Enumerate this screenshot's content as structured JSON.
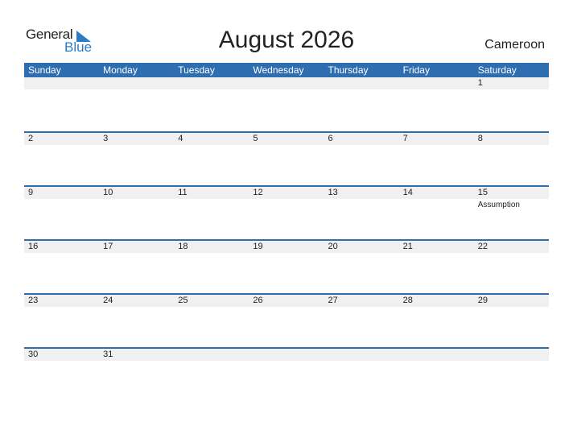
{
  "logo": {
    "text1": "General",
    "text2": "Blue"
  },
  "title": "August 2026",
  "country": "Cameroon",
  "colors": {
    "header": "#2e6eb0",
    "daybar": "#f0f0f0",
    "brand": "#2a7bc8"
  },
  "days": [
    "Sunday",
    "Monday",
    "Tuesday",
    "Wednesday",
    "Thursday",
    "Friday",
    "Saturday"
  ],
  "weeks": [
    [
      {
        "d": ""
      },
      {
        "d": ""
      },
      {
        "d": ""
      },
      {
        "d": ""
      },
      {
        "d": ""
      },
      {
        "d": ""
      },
      {
        "d": "1"
      }
    ],
    [
      {
        "d": "2"
      },
      {
        "d": "3"
      },
      {
        "d": "4"
      },
      {
        "d": "5"
      },
      {
        "d": "6"
      },
      {
        "d": "7"
      },
      {
        "d": "8"
      }
    ],
    [
      {
        "d": "9"
      },
      {
        "d": "10"
      },
      {
        "d": "11"
      },
      {
        "d": "12"
      },
      {
        "d": "13"
      },
      {
        "d": "14"
      },
      {
        "d": "15",
        "h": "Assumption"
      }
    ],
    [
      {
        "d": "16"
      },
      {
        "d": "17"
      },
      {
        "d": "18"
      },
      {
        "d": "19"
      },
      {
        "d": "20"
      },
      {
        "d": "21"
      },
      {
        "d": "22"
      }
    ],
    [
      {
        "d": "23"
      },
      {
        "d": "24"
      },
      {
        "d": "25"
      },
      {
        "d": "26"
      },
      {
        "d": "27"
      },
      {
        "d": "28"
      },
      {
        "d": "29"
      }
    ],
    [
      {
        "d": "30"
      },
      {
        "d": "31"
      },
      {
        "d": ""
      },
      {
        "d": ""
      },
      {
        "d": ""
      },
      {
        "d": ""
      },
      {
        "d": ""
      }
    ]
  ]
}
